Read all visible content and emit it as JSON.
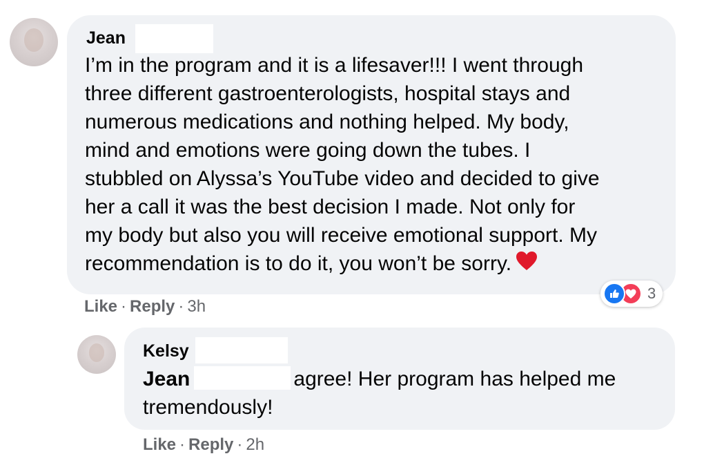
{
  "comment": {
    "author": "Jean",
    "text_lines": [
      "I’m in the program and it is a lifesaver!!! I went through",
      "three different gastroenterologists, hospital stays and",
      "numerous medications and nothing helped. My body,",
      "mind and emotions were going down the tubes. I",
      "stubbled on Alyssa’s YouTube video and decided to give",
      "her a call it was the best decision I made. Not only for",
      "my body but also you will receive emotional support. My",
      "recommendation is to do it, you won’t be sorry."
    ],
    "emoji": "heart-icon",
    "reactions": {
      "count": "3",
      "types": [
        "like",
        "love"
      ]
    },
    "actions": {
      "like": "Like",
      "reply": "Reply",
      "separator": "·",
      "time": "3h"
    }
  },
  "reply": {
    "author": "Kelsy",
    "mention": "Jean",
    "text_first": "agree! Her program has helped me",
    "text_second": "tremendously!",
    "actions": {
      "like": "Like",
      "reply": "Reply",
      "separator": "·",
      "time": "2h"
    }
  },
  "colors": {
    "bubble": "#f0f2f5",
    "secondary_text": "#65676b",
    "like_blue": "#1877f2",
    "love_red": "#f33e58"
  }
}
